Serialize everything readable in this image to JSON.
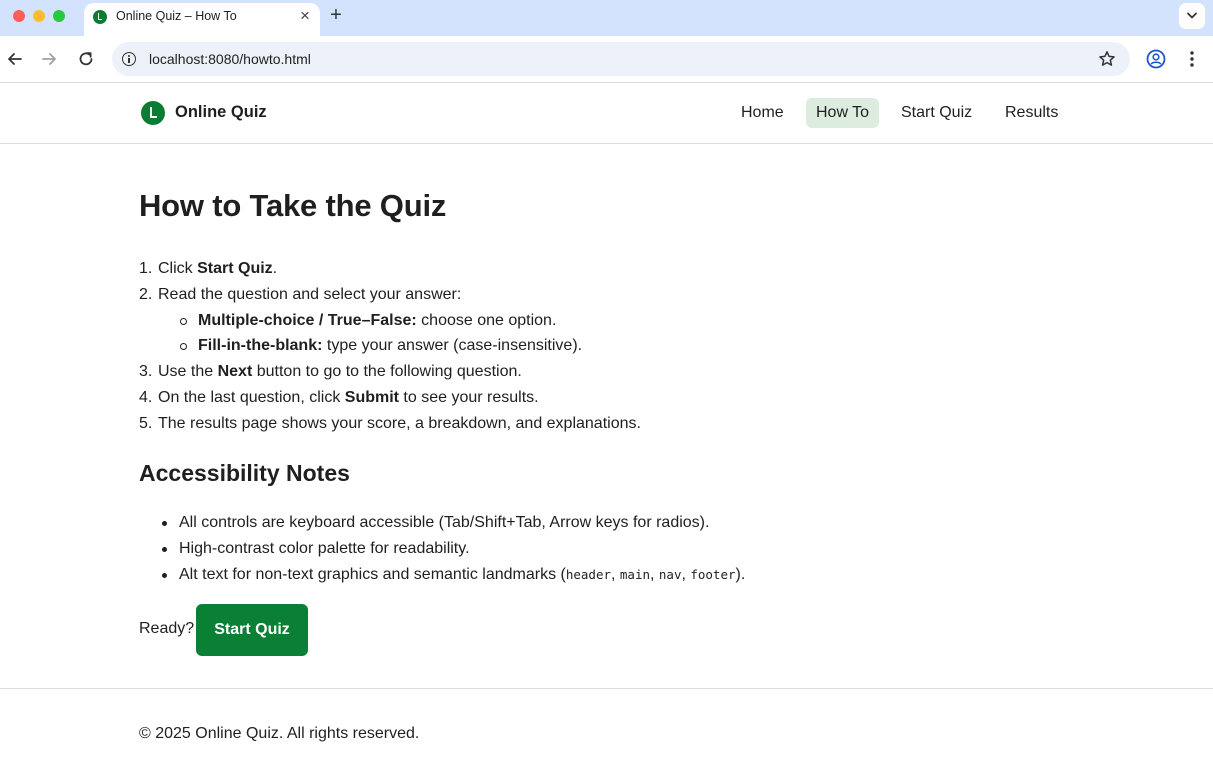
{
  "browser": {
    "tab_title": "Online Quiz – How To",
    "tab_close": "×",
    "new_tab": "+",
    "url": "localhost:8080/howto.html"
  },
  "site": {
    "brand": "Online Quiz",
    "nav": {
      "home": "Home",
      "howto": "How To",
      "start": "Start Quiz",
      "results": "Results"
    },
    "active_nav": "How To",
    "accent_color": "#0a8035",
    "active_nav_bg": "#dcecdf"
  },
  "main": {
    "title": "How to Take the Quiz",
    "steps": {
      "s1": {
        "num": "1.",
        "pre": "Click ",
        "bold": "Start Quiz",
        "post": "."
      },
      "s2": {
        "num": "2.",
        "text": "Read the question and select your answer:",
        "sub1": {
          "bold": "Multiple-choice / True–False:",
          "post": " choose one option."
        },
        "sub2": {
          "bold": "Fill-in-the-blank:",
          "post": " type your answer (case-insensitive)."
        }
      },
      "s3": {
        "num": "3.",
        "pre": "Use the ",
        "bold": "Next",
        "post": " button to go to the following question."
      },
      "s4": {
        "num": "4.",
        "pre": "On the last question, click ",
        "bold": "Submit",
        "post": " to see your results."
      },
      "s5": {
        "num": "5.",
        "text": "The results page shows your score, a breakdown, and explanations."
      }
    },
    "accessibility": {
      "title": "Accessibility Notes",
      "note1": "All controls are keyboard accessible (Tab/Shift+Tab, Arrow keys for radios).",
      "note2": "High-contrast color palette for readability.",
      "note3": {
        "pre": "Alt text for non-text graphics and semantic landmarks (",
        "code1": "header",
        "code2": "main",
        "code3": "nav",
        "code4": "footer",
        "sep": ", ",
        "post": ")."
      }
    },
    "ready_label": "Ready?",
    "start_button": "Start Quiz"
  },
  "footer": {
    "text": "© 2025 Online Quiz. All rights reserved."
  }
}
